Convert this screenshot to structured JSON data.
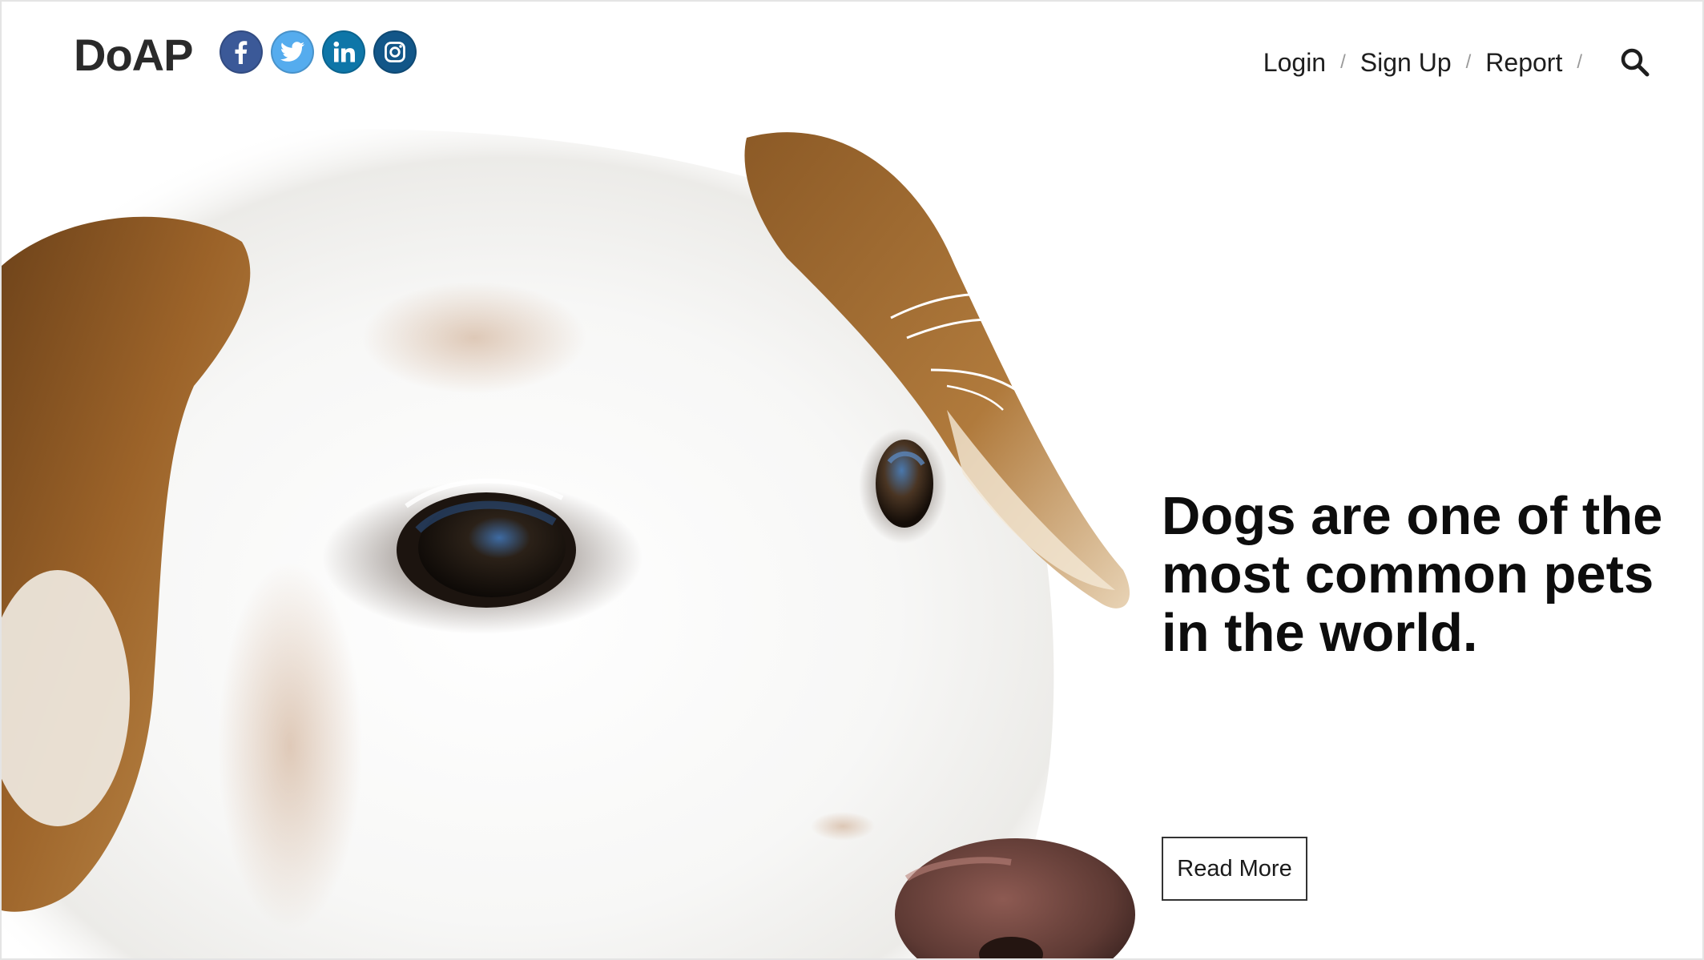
{
  "header": {
    "logo": "DoAP",
    "social": [
      {
        "name": "facebook-icon",
        "color": "#3b5998",
        "glyph": "f"
      },
      {
        "name": "twitter-icon",
        "color": "#55acee",
        "glyph": "bird"
      },
      {
        "name": "linkedin-icon",
        "color": "#0e76a8",
        "glyph": "in"
      },
      {
        "name": "instagram-icon",
        "color": "#125688",
        "glyph": "camera"
      }
    ],
    "nav": {
      "login": "Login",
      "signup": "Sign Up",
      "report": "Report",
      "separator": "/",
      "search_icon": "search-icon"
    }
  },
  "hero": {
    "headline": "Dogs are one of the most common pets in the world.",
    "button": "Read More",
    "image": "white and brown dog close-up"
  },
  "colors": {
    "text": "#0d0d0d",
    "fur_brown": "#a86a2c",
    "button_border": "#333333"
  }
}
